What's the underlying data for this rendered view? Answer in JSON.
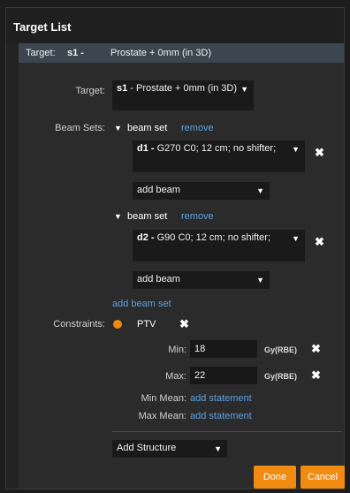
{
  "window": {
    "title": "Target List"
  },
  "header": {
    "prefix": "Target:",
    "target_id": "s1 -",
    "target_name": "Prostate + 0mm (in 3D)"
  },
  "target_field": {
    "label": "Target:",
    "value_id": "s1",
    "value_text": " - Prostate + 0mm (in 3D)"
  },
  "beam_sets": {
    "label": "Beam Sets:",
    "remove_label": "remove",
    "sets": [
      {
        "title": "beam set",
        "beam_id": "d1 -",
        "beam_text": " G270 C0; 12 cm; no shifter;",
        "add_beam": "add beam"
      },
      {
        "title": "beam set",
        "beam_id": "d2 -",
        "beam_text": " G90 C0; 12 cm; no shifter;",
        "add_beam": "add beam"
      }
    ],
    "add_beam_set": "add beam set"
  },
  "constraints": {
    "label": "Constraints:",
    "structure": "PTV",
    "structure_color": "#f08a10",
    "min_label": "Min:",
    "min_value": "18",
    "max_label": "Max:",
    "max_value": "22",
    "unit": "Gy(RBE)",
    "min_mean_label": "Min Mean:",
    "max_mean_label": "Max Mean:",
    "add_statement": "add statement"
  },
  "add_structure": "Add Structure",
  "buttons": {
    "done": "Done",
    "cancel": "Cancel"
  },
  "colors": {
    "accent": "#f08a10",
    "link": "#5aa0e0",
    "header_bar": "#3c4650"
  }
}
